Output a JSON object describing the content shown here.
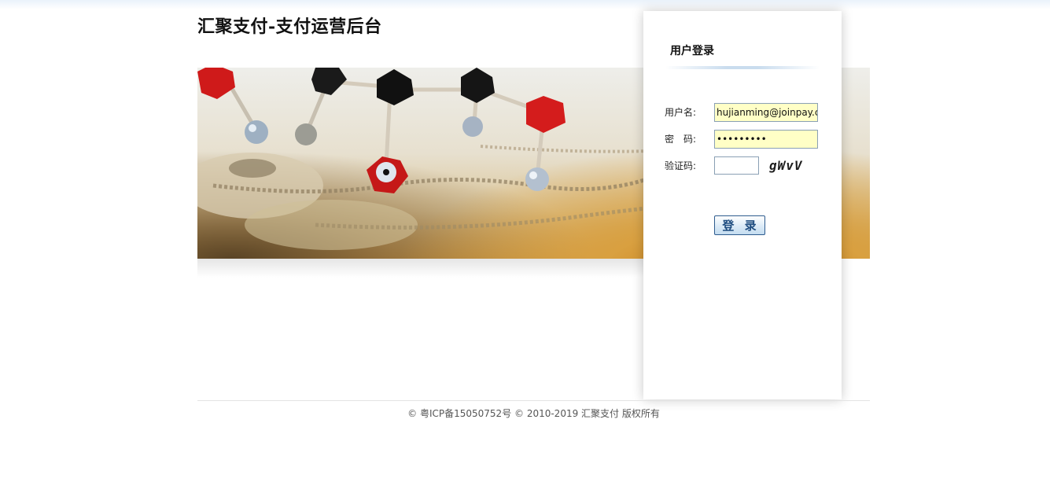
{
  "header": {
    "title": "汇聚支付-支付运营后台"
  },
  "login": {
    "title": "用户登录",
    "username_label": "用户名:",
    "username_value": "hujianming@joinpay.cc",
    "password_label": "密　码:",
    "password_value": "•••••••••",
    "captcha_label": "验证码:",
    "captcha_value": "",
    "captcha_text": "gWvV",
    "submit_label": "登 录"
  },
  "footer": {
    "text": "© 粤ICP备15050752号 © 2010-2019 汇聚支付 版权所有"
  },
  "colors": {
    "input_bg": "#ffffc6",
    "button_text": "#1f4d80"
  }
}
